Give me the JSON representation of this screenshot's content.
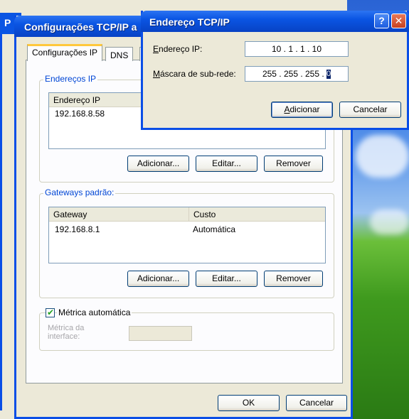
{
  "colors": {
    "xp_blue": "#0a55e3",
    "group_legend": "#0046d5",
    "dialog_bg": "#ece9d8"
  },
  "parent_window": {
    "title_letter": "P"
  },
  "main_dialog": {
    "title": "Configurações TCP/IP a",
    "tabs": [
      {
        "label": "Configurações IP",
        "active": true
      },
      {
        "label": "DNS",
        "active": false
      }
    ],
    "ip_addresses": {
      "legend": "Endereços IP",
      "columns": [
        "Endereço IP"
      ],
      "rows": [
        "192.168.8.58"
      ],
      "buttons": {
        "add": "Adicionar...",
        "edit": "Editar...",
        "remove": "Remover"
      }
    },
    "gateways": {
      "legend": "Gateways padrão:",
      "columns": [
        "Gateway",
        "Custo"
      ],
      "rows": [
        {
          "gateway": "192.168.8.1",
          "cost": "Automática"
        }
      ],
      "buttons": {
        "add": "Adicionar...",
        "edit": "Editar...",
        "remove": "Remover"
      }
    },
    "metric": {
      "checkbox_label": "Métrica automática",
      "checked": true,
      "interface_metric_label_1": "Métrica da",
      "interface_metric_label_2": "interface:",
      "interface_metric_value": ""
    },
    "footer": {
      "ok": "OK",
      "cancel": "Cancelar"
    }
  },
  "tcpip_dialog": {
    "title": "Endereço TCP/IP",
    "help_icon": "help-icon",
    "close_icon": "close-icon",
    "ip_label_accel": "E",
    "ip_label_rest": "ndereço IP:",
    "ip_value": "10  .  1  .  1  .  10",
    "mask_label_accel": "M",
    "mask_label_rest": "áscara de sub-rede:",
    "mask_value_prefix": "255 . 255 . 255 . ",
    "mask_value_caret": "0",
    "add_accel": "A",
    "add_rest": "dicionar",
    "cancel": "Cancelar"
  }
}
